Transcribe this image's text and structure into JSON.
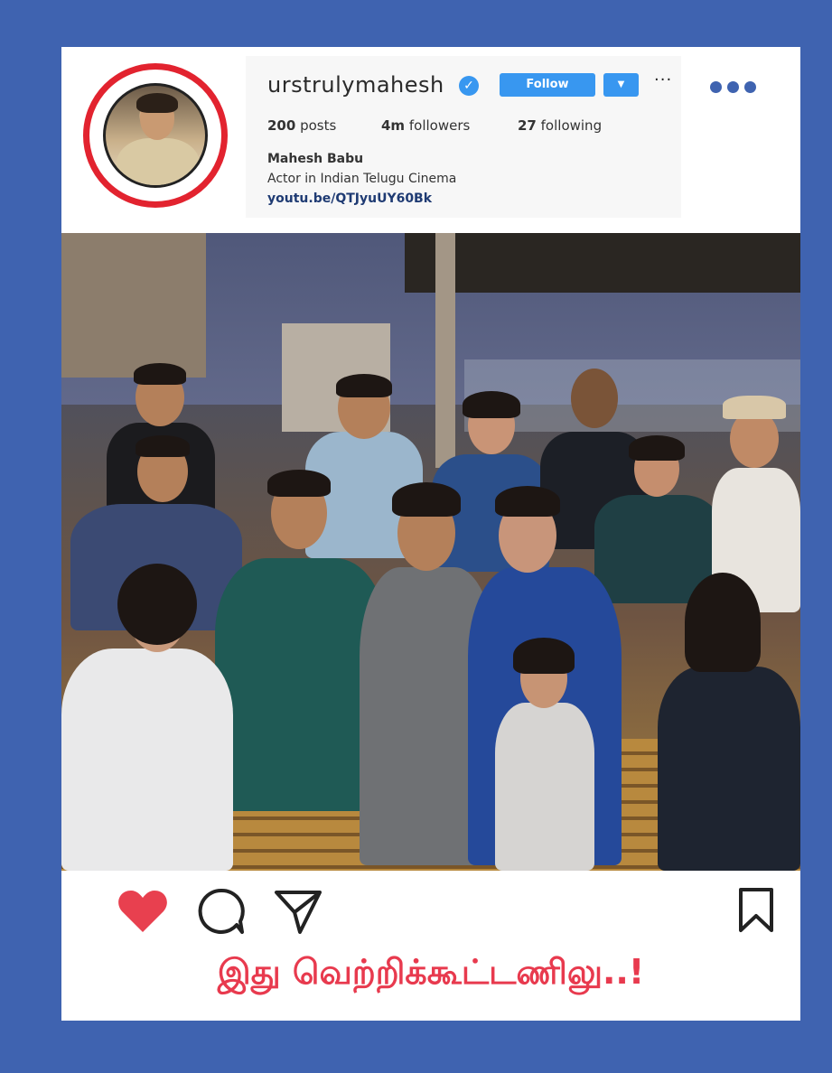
{
  "profile": {
    "username": "urstrulymahesh",
    "verified": true,
    "follow_label": "Follow",
    "options_label": "···",
    "stats": {
      "posts_count": "200",
      "posts_label": "posts",
      "followers_count": "4m",
      "followers_label": "followers",
      "following_count": "27",
      "following_label": "following"
    },
    "name": "Mahesh Babu",
    "bio": "Actor in Indian Telugu Cinema",
    "link": "youtu.be/QTJyuUY60Bk"
  },
  "post": {
    "caption": "இது வெற்றிக்கூட்டணிலு..!"
  },
  "icons": {
    "verified": "verified-badge-icon",
    "dropdown": "chevron-down-icon",
    "more": "more-dots-icon",
    "like": "heart-icon",
    "comment": "comment-icon",
    "share": "share-icon",
    "save": "bookmark-icon"
  },
  "colors": {
    "background": "#3f63b0",
    "card": "#ffffff",
    "avatar_ring": "#e2232f",
    "follow_button": "#3897f0",
    "like": "#e8404f",
    "caption": "#e83a4e",
    "more_dots": "#3f63b0"
  }
}
